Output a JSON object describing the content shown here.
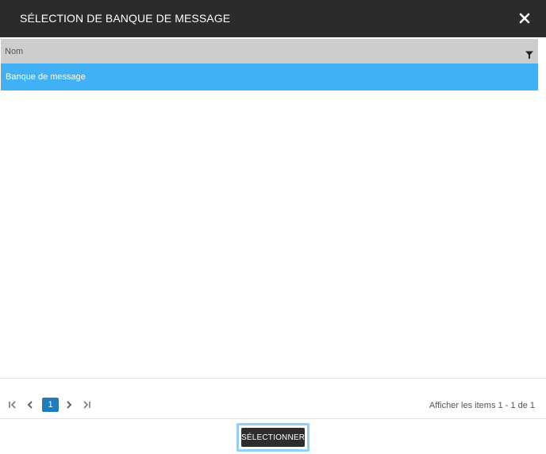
{
  "dialog": {
    "title": "SÉLECTION DE BANQUE DE MESSAGE",
    "close_icon": "close-icon"
  },
  "grid": {
    "columns": [
      {
        "label": "Nom",
        "filter_icon": "filter-icon"
      }
    ],
    "rows": [
      {
        "name": "Banque de message",
        "selected": true
      }
    ]
  },
  "pager": {
    "current_page": "1",
    "info": "Afficher les items 1 - 1 de 1",
    "icons": [
      "first-page-icon",
      "prev-page-icon",
      "next-page-icon",
      "last-page-icon"
    ]
  },
  "footer": {
    "select_label": "SÉLECTIONNER"
  },
  "colors": {
    "titlebar": "#2b2b2b",
    "header": "#cdcdcd",
    "selected_row": "#41b0f4",
    "page_active": "#1f7cbd",
    "button": "#2e2e2e",
    "button_focus": "#8ed0f6"
  }
}
